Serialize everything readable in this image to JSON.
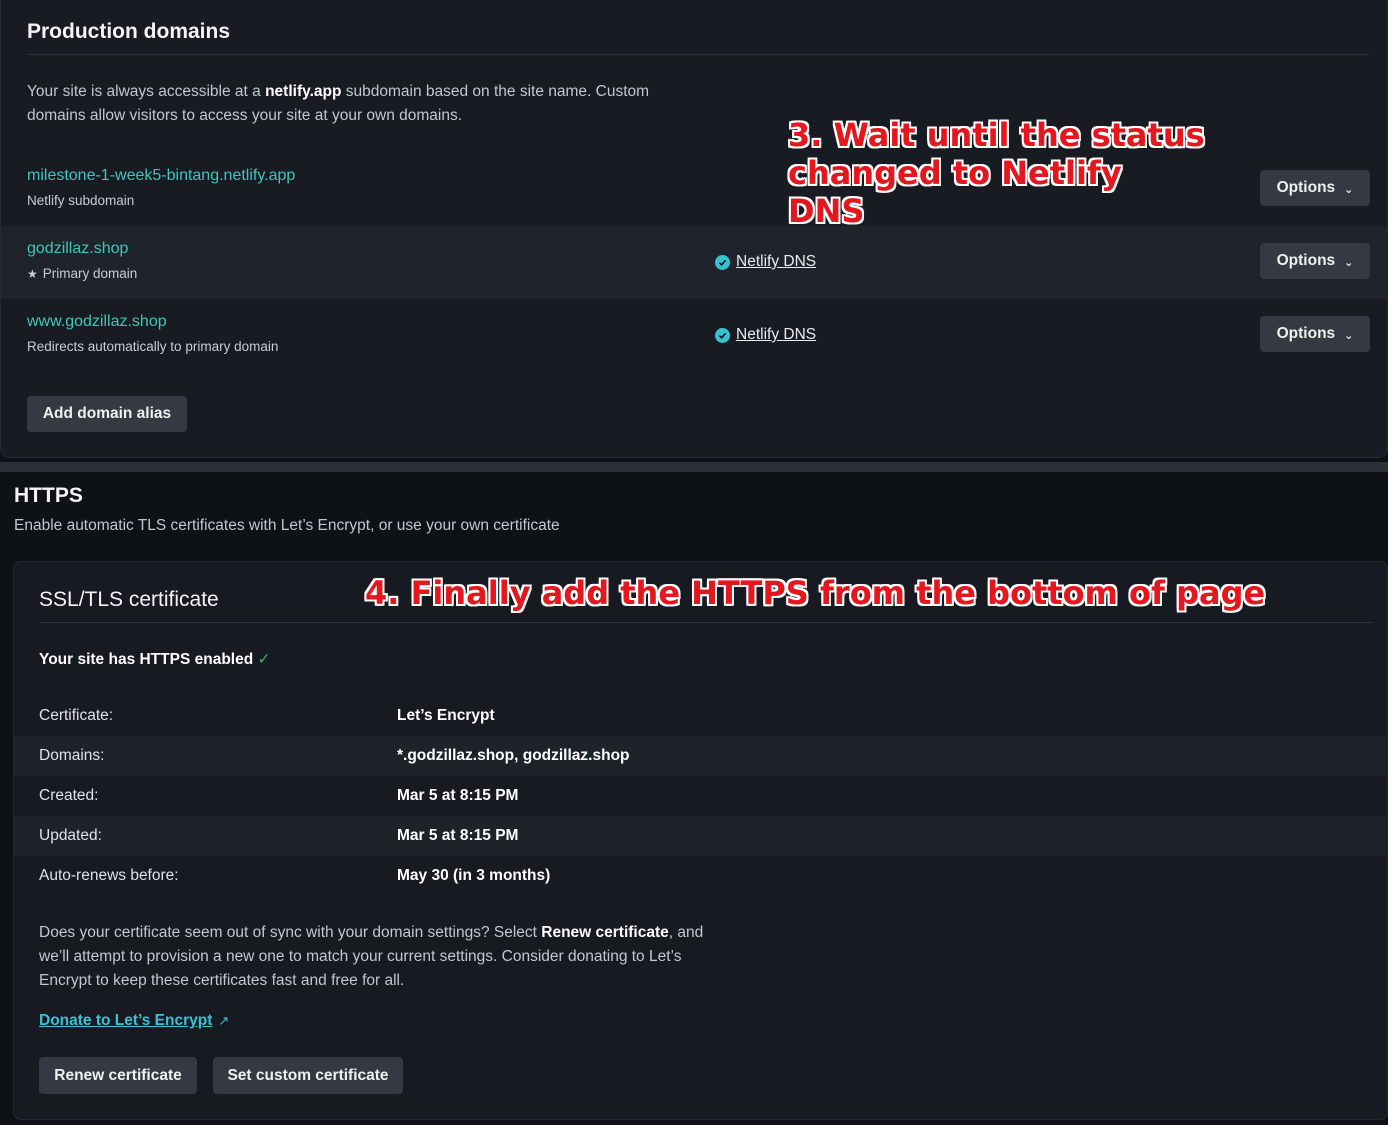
{
  "production": {
    "title": "Production domains",
    "desc_prefix": "Your site is always accessible at a ",
    "desc_bold": "netlify.app",
    "desc_line1_rest": " subdomain based on the site name. Custom",
    "desc_line2": "domains allow visitors to access your site at your own domains.",
    "domains": [
      {
        "name": "milestone-1-week5-bintang.netlify.app",
        "sub": "Netlify subdomain",
        "dns": "",
        "options": "Options"
      },
      {
        "name": "godzillaz.shop",
        "sub": "Primary domain",
        "dns": "Netlify DNS",
        "options": "Options"
      },
      {
        "name": "www.godzillaz.shop",
        "sub": "Redirects automatically to primary domain",
        "dns": "Netlify DNS",
        "options": "Options"
      }
    ],
    "add_alias": "Add domain alias"
  },
  "annotations": {
    "step3_l1": "3. Wait until the status",
    "step3_l2": "changed to Netlify",
    "step3_l3": "DNS",
    "step4": "4. Finally add the HTTPS from the bottom of page"
  },
  "https": {
    "title": "HTTPS",
    "subtitle": "Enable automatic TLS certificates with Let’s Encrypt, or use your own certificate"
  },
  "ssl": {
    "title": "SSL/TLS certificate",
    "enabled_text": "Your site has HTTPS enabled",
    "enabled_check": "✓",
    "rows": [
      {
        "label": "Certificate:",
        "value": "Let’s Encrypt"
      },
      {
        "label": "Domains:",
        "value": "*.godzillaz.shop, godzillaz.shop"
      },
      {
        "label": "Created:",
        "value": "Mar 5 at 8:15 PM"
      },
      {
        "label": "Updated:",
        "value": "Mar 5 at 8:15 PM"
      },
      {
        "label": "Auto-renews before:",
        "value": "May 30 (in 3 months)"
      }
    ],
    "note_part1": "Does your certificate seem out of sync with your domain settings? Select ",
    "note_bold": "Renew certificate",
    "note_part2": ", and",
    "note_line2": "we’ll attempt to provision a new one to match your current settings. Consider donating to Let’s",
    "note_line3": "Encrypt to keep these certificates fast and free for all.",
    "donate": "Donate to Let’s Encrypt",
    "renew_button": "Renew certificate",
    "custom_button": "Set custom certificate"
  },
  "colors": {
    "accent_teal": "#3ec6b8",
    "annotation_red": "#e4161e",
    "check_cyan": "#36c2cf"
  }
}
